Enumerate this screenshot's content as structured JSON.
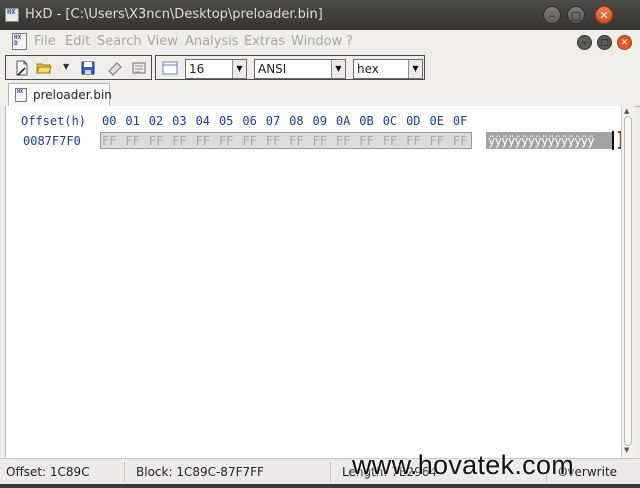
{
  "window": {
    "title": "HxD - [C:\\Users\\X3ncn\\Desktop\\preloader.bin]",
    "minimize_glyph": "–",
    "maximize_glyph": "□",
    "close_glyph": "✕"
  },
  "menu": {
    "items": [
      "File",
      "Edit",
      "Search",
      "View",
      "Analysis",
      "Extras",
      "Window",
      "?"
    ]
  },
  "toolbar": {
    "bytes_per_row": "16",
    "charset": "ANSI",
    "offset_base": "hex"
  },
  "tabs": [
    {
      "label": "preloader.bin"
    }
  ],
  "editor": {
    "offset_header": "Offset(h)",
    "column_headers": [
      "00",
      "01",
      "02",
      "03",
      "04",
      "05",
      "06",
      "07",
      "08",
      "09",
      "0A",
      "0B",
      "0C",
      "0D",
      "0E",
      "0F"
    ],
    "rows": [
      {
        "offset": "0087F7F0",
        "bytes": [
          "FF",
          "FF",
          "FF",
          "FF",
          "FF",
          "FF",
          "FF",
          "FF",
          "FF",
          "FF",
          "FF",
          "FF",
          "FF",
          "FF",
          "FF",
          "FF"
        ],
        "text": "ÿÿÿÿÿÿÿÿÿÿÿÿÿÿÿÿ"
      }
    ]
  },
  "status": {
    "offset": "Offset: 1C89C",
    "block": "Block: 1C89C-87F7FF",
    "length": "Length: 7E2964",
    "mode": "Overwrite"
  },
  "watermark": "www.hovatek.com",
  "colors": {
    "offset_blue": "#1f3a9d",
    "selection_gray": "#a3a3a3",
    "close_orange": "#e0592a"
  }
}
